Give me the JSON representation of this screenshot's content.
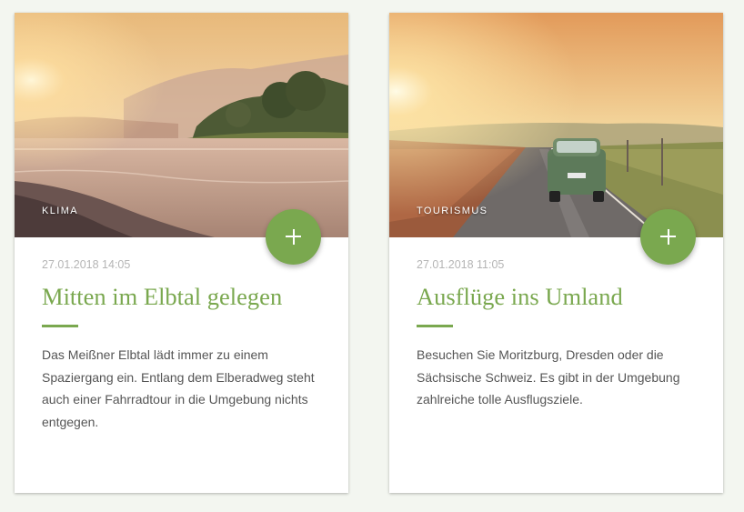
{
  "articles": [
    {
      "category": "KLIMA",
      "date": "27.01.2018 14:05",
      "title": "Mitten im Elbtal gelegen",
      "description": "Das Meißner Elbtal lädt immer zu einem Spaziergang ein. Entlang dem Elberadweg steht auch einer Fahrradtour in die Umgebung nichts entgegen."
    },
    {
      "category": "TOURISMUS",
      "date": "27.01.2018 11:05",
      "title": "Ausflüge ins Umland",
      "description": "Besuchen Sie Moritzburg, Dresden oder die Sächsische Schweiz. Es gibt in der Umgebung zahlreiche tolle Ausflugsziele."
    }
  ],
  "colors": {
    "accent": "#7aa84f",
    "background": "#f3f6f0",
    "date_text": "#b5b5b5",
    "body_text": "#555555"
  },
  "icons": {
    "expand_button": "plus-icon"
  }
}
